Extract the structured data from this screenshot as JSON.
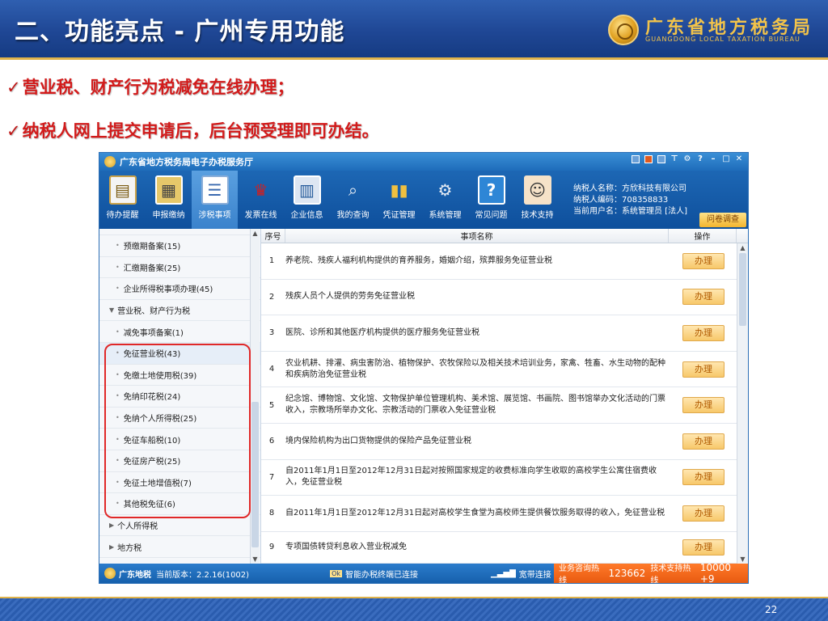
{
  "slide": {
    "title": "二、功能亮点 - 广州专用功能",
    "bureau_cn": "广东省地方税务局",
    "bureau_en": "GUANGDONG LOCAL TAXATION BUREAU",
    "bullets": [
      "营业税、财产行为税减免在线办理；",
      "纳税人网上提交申请后，后台预受理即可办结。"
    ],
    "check": "✓",
    "page_number": "22"
  },
  "app": {
    "title": "广东省地方税务局电子办税服务厅",
    "toolbar": [
      {
        "label": "待办提醒",
        "icon": "clipboard-icon",
        "glyph": "▤"
      },
      {
        "label": "申报缴纳",
        "icon": "monitor-icon",
        "glyph": "▦"
      },
      {
        "label": "涉税事项",
        "icon": "form-icon",
        "glyph": "☰"
      },
      {
        "label": "发票在线",
        "icon": "stamp-icon",
        "glyph": "♛"
      },
      {
        "label": "企业信息",
        "icon": "building-icon",
        "glyph": "▥"
      },
      {
        "label": "我的查询",
        "icon": "magnifier-icon",
        "glyph": "⌕"
      },
      {
        "label": "凭证管理",
        "icon": "binders-icon",
        "glyph": "▮▮"
      },
      {
        "label": "系统管理",
        "icon": "gear-icon",
        "glyph": "⚙"
      },
      {
        "label": "常见问题",
        "icon": "question-icon",
        "glyph": "?"
      },
      {
        "label": "技术支持",
        "icon": "agent-icon",
        "glyph": "☺"
      }
    ],
    "user": {
      "name_line": "纳税人名称：方欣科技有限公司",
      "code_line": "纳税人编码：708358833",
      "current_user_line": "当前用户名：系统管理员 [法人]"
    },
    "survey_label": "问卷调查",
    "sidebar": [
      {
        "label": "预缴期备案(15)",
        "type": "item"
      },
      {
        "label": "汇缴期备案(25)",
        "type": "item"
      },
      {
        "label": "企业所得税事项办理(45)",
        "type": "item"
      },
      {
        "label": "营业税、财产行为税",
        "type": "group-open"
      },
      {
        "label": "减免事项备案(1)",
        "type": "item"
      },
      {
        "label": "免征营业税(43)",
        "type": "item"
      },
      {
        "label": "免缴土地使用税(39)",
        "type": "item"
      },
      {
        "label": "免纳印花税(24)",
        "type": "item"
      },
      {
        "label": "免纳个人所得税(25)",
        "type": "item"
      },
      {
        "label": "免征车船税(10)",
        "type": "item"
      },
      {
        "label": "免征房产税(25)",
        "type": "item"
      },
      {
        "label": "免征土地增值税(7)",
        "type": "item"
      },
      {
        "label": "其他税免征(6)",
        "type": "item"
      },
      {
        "label": "个人所得税",
        "type": "group-closed"
      },
      {
        "label": "地方税",
        "type": "group-closed"
      }
    ],
    "table": {
      "headers": [
        "序号",
        "事项名称",
        "操作"
      ],
      "button_label": "办理",
      "rows": [
        {
          "no": "1",
          "name": "养老院、残疾人福利机构提供的育养服务，婚姻介绍，殡葬服务免征营业税"
        },
        {
          "no": "2",
          "name": "残疾人员个人提供的劳务免征营业税"
        },
        {
          "no": "3",
          "name": "医院、诊所和其他医疗机构提供的医疗服务免征营业税"
        },
        {
          "no": "4",
          "name": "农业机耕、排灌、病虫害防治、植物保护、农牧保险以及相关技术培训业务，家禽、牲畜、水生动物的配种和疾病防治免征营业税"
        },
        {
          "no": "5",
          "name": "纪念馆、博物馆、文化馆、文物保护单位管理机构、美术馆、展览馆、书画院、图书馆举办文化活动的门票收入，宗教场所举办文化、宗教活动的门票收入免征营业税"
        },
        {
          "no": "6",
          "name": "境内保险机构为出口货物提供的保险产品免征营业税"
        },
        {
          "no": "7",
          "name": "自2011年1月1日至2012年12月31日起对按照国家规定的收费标准向学生收取的高校学生公寓住宿费收入，免征营业税"
        },
        {
          "no": "8",
          "name": "自2011年1月1日至2012年12月31日起对高校学生食堂为高校师生提供餐饮服务取得的收入，免征营业税"
        },
        {
          "no": "9",
          "name": "专项国债转贷利息收入营业税减免"
        }
      ]
    },
    "status": {
      "app_name": "广东地税",
      "version": "当前版本：2.2.16(1002)",
      "conn_badge": "Ok",
      "conn_text": "智能办税终端已连接",
      "broadband": "宽带连接",
      "hotline_label": "业务咨询热线",
      "hotline_num": "123662",
      "support_label": "技术支持热线",
      "support_num": "10000 +9"
    }
  }
}
